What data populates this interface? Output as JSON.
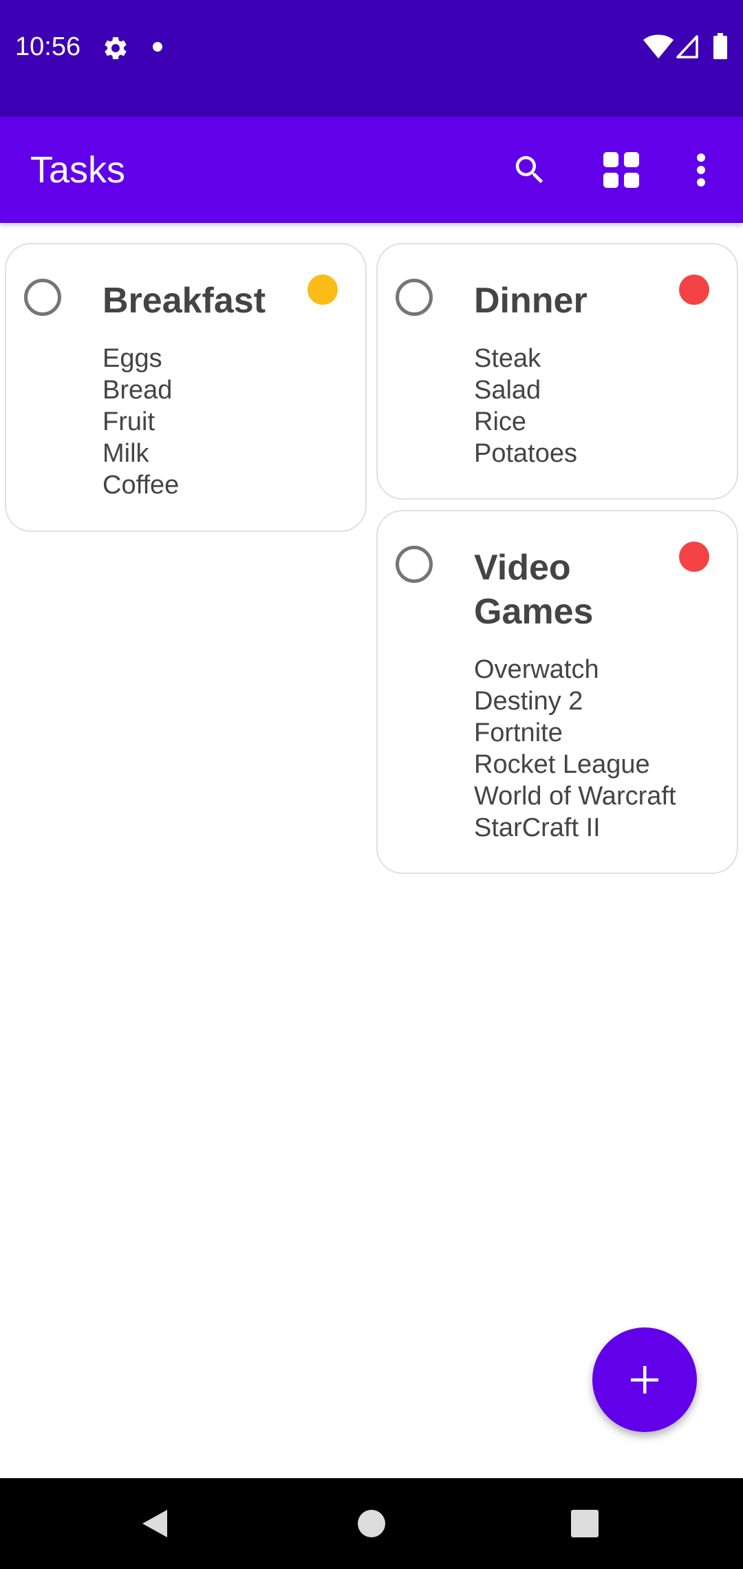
{
  "status_bar": {
    "time": "10:56",
    "icons": [
      "gear-icon",
      "notification-dot-icon",
      "wifi-icon",
      "signal-icon",
      "battery-icon"
    ]
  },
  "app_bar": {
    "title": "Tasks",
    "actions": [
      "search-icon",
      "grid-view-icon",
      "more-vert-icon"
    ]
  },
  "colors": {
    "status_bar": "#3d00b5",
    "app_bar": "#6200ea",
    "accent": "#6200ea",
    "priority_medium": "#fbbc16",
    "priority_high": "#f44344",
    "text": "#444444",
    "card_border": "#e0e0e0"
  },
  "cards": [
    {
      "title": "Breakfast",
      "priority_color": "#fbbc16",
      "completed": false,
      "items": [
        "Eggs",
        "Bread",
        "Fruit",
        "Milk",
        "Coffee"
      ]
    },
    {
      "title": "Dinner",
      "priority_color": "#f44344",
      "completed": false,
      "items": [
        "Steak",
        "Salad",
        "Rice",
        "Potatoes"
      ]
    },
    {
      "title": "Video Games",
      "priority_color": "#f44344",
      "completed": false,
      "items": [
        "Overwatch",
        "Destiny 2",
        "Fortnite",
        "Rocket League",
        "World of Warcraft",
        "StarCraft II"
      ]
    }
  ],
  "fab": {
    "icon": "plus-icon"
  },
  "nav_bar": {
    "icons": [
      "back-icon",
      "home-icon",
      "recents-icon"
    ]
  }
}
